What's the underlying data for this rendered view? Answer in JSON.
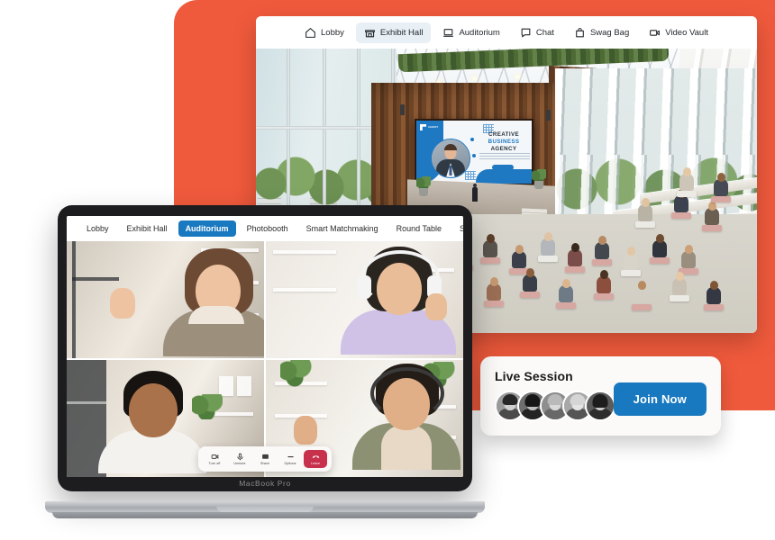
{
  "colors": {
    "orange_backdrop": "#F05A3C",
    "accent_blue": "#1878C0",
    "leave_red": "#C8314C",
    "nav_active_bg": "#E8EFF5"
  },
  "browser_window": {
    "nav_items": [
      {
        "label": "Lobby",
        "icon": "home-icon",
        "active": false
      },
      {
        "label": "Exhibit Hall",
        "icon": "store-icon",
        "active": true
      },
      {
        "label": "Auditorium",
        "icon": "laptop-icon",
        "active": false
      },
      {
        "label": "Chat",
        "icon": "chat-bubble-icon",
        "active": false
      },
      {
        "label": "Swag Bag",
        "icon": "shopping-bag-icon",
        "active": false
      },
      {
        "label": "Video Vault",
        "icon": "video-camera-icon",
        "active": false
      }
    ],
    "scene": {
      "description": "3D virtual auditorium with seated audience facing a stage",
      "presentation_slide": {
        "title_line_1": "CREATIVE",
        "title_line_2": "BUSINESS",
        "title_line_3": "AGENCY"
      }
    }
  },
  "live_session_card": {
    "title": "Live Session",
    "join_button_label": "Join Now",
    "attendee_avatar_count": 5
  },
  "macbook": {
    "model_label": "MacBook Pro",
    "tabs": [
      {
        "label": "Lobby",
        "active": false
      },
      {
        "label": "Exhibit Hall",
        "active": false
      },
      {
        "label": "Auditorium",
        "active": true
      },
      {
        "label": "Photobooth",
        "active": false
      },
      {
        "label": "Smart Matchmaking",
        "active": false
      },
      {
        "label": "Round Table",
        "active": false
      },
      {
        "label": "Spatial Connect",
        "active": false
      }
    ],
    "video_grid": {
      "participant_count": 4,
      "participants": [
        {
          "position": "top-left",
          "description": "woman waving, beige turtleneck"
        },
        {
          "position": "top-right",
          "description": "woman with white headphones, lilac hoodie"
        },
        {
          "position": "bottom-left",
          "description": "man in white t-shirt"
        },
        {
          "position": "bottom-right",
          "description": "woman waving with headset, olive cardigan"
        }
      ]
    },
    "call_controls": [
      {
        "label": "Turn off",
        "icon": "camera-icon",
        "variant": "default"
      },
      {
        "label": "Unmute",
        "icon": "microphone-icon",
        "variant": "default"
      },
      {
        "label": "Share",
        "icon": "screen-share-icon",
        "variant": "default"
      },
      {
        "label": "Options",
        "icon": "more-options-icon",
        "variant": "default"
      },
      {
        "label": "Leave",
        "icon": "end-call-icon",
        "variant": "danger"
      }
    ]
  }
}
